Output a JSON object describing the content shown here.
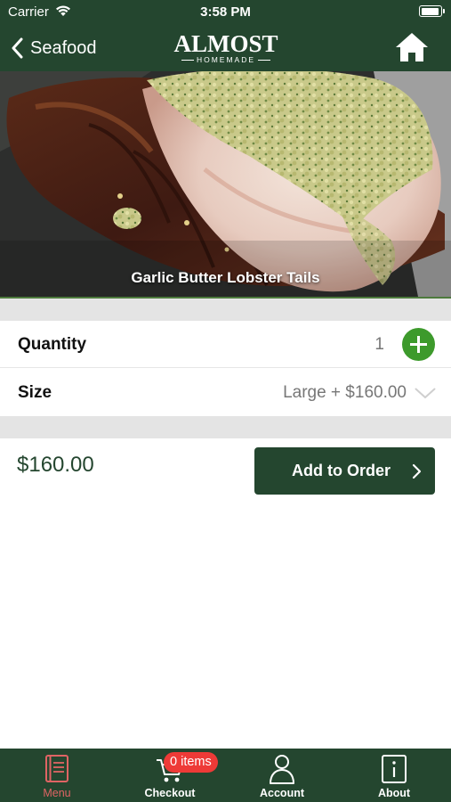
{
  "status_bar": {
    "carrier": "Carrier",
    "time": "3:58 PM"
  },
  "nav": {
    "back_label": "Seafood",
    "logo_main": "ALMOST",
    "logo_sub": "HOMEMADE"
  },
  "hero": {
    "title": "Garlic Butter Lobster Tails"
  },
  "options": {
    "quantity_label": "Quantity",
    "quantity_value": "1",
    "size_label": "Size",
    "size_value": "Large + $160.00"
  },
  "order": {
    "price": "$160.00",
    "add_label": "Add to Order"
  },
  "tabs": [
    {
      "label": "Menu",
      "icon": "menu-book-icon",
      "active": true
    },
    {
      "label": "Checkout",
      "icon": "cart-icon",
      "badge": "0 items"
    },
    {
      "label": "Account",
      "icon": "person-icon"
    },
    {
      "label": "About",
      "icon": "info-icon"
    }
  ],
  "colors": {
    "brand_green": "#24462f",
    "accent_green": "#3d9a2c",
    "badge_red": "#ee3a37",
    "active_tab": "#e06464"
  }
}
